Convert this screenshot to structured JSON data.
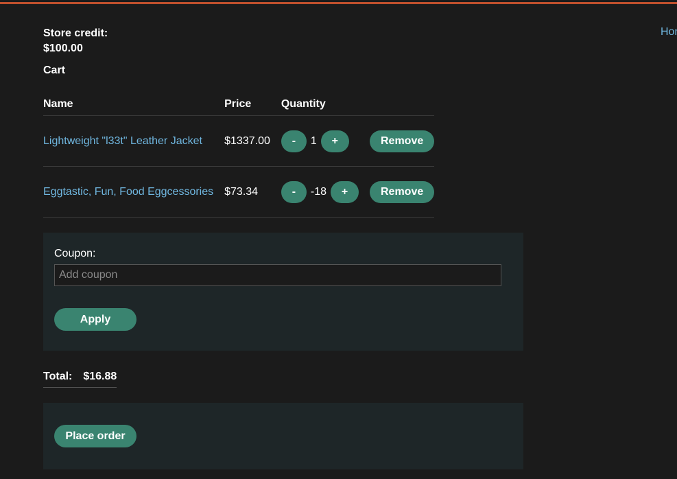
{
  "nav": {
    "home_link": "Home"
  },
  "store_credit": {
    "label": "Store credit:",
    "value": "$100.00"
  },
  "cart": {
    "heading": "Cart",
    "columns": {
      "name": "Name",
      "price": "Price",
      "quantity": "Quantity"
    },
    "items": [
      {
        "name": "Lightweight \"l33t\" Leather Jacket",
        "price": "$1337.00",
        "quantity": "1",
        "decrement_label": "-",
        "increment_label": "+",
        "remove_label": "Remove"
      },
      {
        "name": "Eggtastic, Fun, Food Eggcessories",
        "price": "$73.34",
        "quantity": "-18",
        "decrement_label": "-",
        "increment_label": "+",
        "remove_label": "Remove"
      }
    ]
  },
  "coupon": {
    "label": "Coupon:",
    "placeholder": "Add coupon",
    "value": "",
    "apply_label": "Apply"
  },
  "total": {
    "label": "Total:",
    "value": "$16.88"
  },
  "order": {
    "place_order_label": "Place order"
  },
  "colors": {
    "accent_bar": "#c0502d",
    "button": "#3a8470",
    "link": "#70b7e0",
    "background": "#1b1b1b",
    "panel": "#1e2628"
  }
}
